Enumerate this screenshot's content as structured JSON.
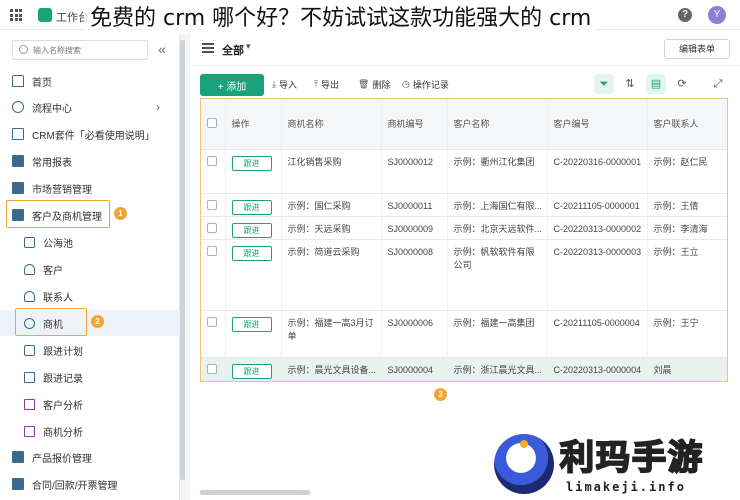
{
  "header": {
    "app_name": "工作台",
    "overlay_title": "免费的 crm 哪个好？不妨试试这款功能强大的 crm",
    "help_label": "?",
    "avatar_label": "Y"
  },
  "sidebar": {
    "search_placeholder": "输入名称搜索",
    "collapse_label": "«",
    "items": [
      {
        "label": "首页",
        "icon": "home-icon"
      },
      {
        "label": "流程中心",
        "icon": "flow-icon",
        "chevron": "›"
      },
      {
        "label": "CRM套件「必看使用说明」",
        "icon": "doc-icon"
      },
      {
        "label": "常用报表",
        "icon": "folder-icon"
      },
      {
        "label": "市场营销管理",
        "icon": "folder-icon"
      },
      {
        "label": "客户及商机管理",
        "icon": "folder-icon",
        "badge": "1"
      },
      {
        "label": "公海池",
        "icon": "pool-icon"
      },
      {
        "label": "客户",
        "icon": "customer-icon"
      },
      {
        "label": "联系人",
        "icon": "contact-icon"
      },
      {
        "label": "商机",
        "icon": "opportunity-icon",
        "badge": "2"
      },
      {
        "label": "跟进计划",
        "icon": "calendar-icon"
      },
      {
        "label": "跟进记录",
        "icon": "record-icon"
      },
      {
        "label": "客户分析",
        "icon": "chart-icon"
      },
      {
        "label": "商机分析",
        "icon": "chart-icon"
      },
      {
        "label": "产品报价管理",
        "icon": "folder-icon"
      },
      {
        "label": "合同/回款/开票管理",
        "icon": "folder-icon"
      }
    ]
  },
  "main": {
    "view_label": "全部",
    "edit_form_label": "编辑表单",
    "toolbar": {
      "add_label": "+ 添加",
      "import_label": "导入",
      "export_label": "导出",
      "delete_label": "删除",
      "log_label": "操作记录"
    },
    "columns": [
      "操作",
      "商机名称",
      "商机编号",
      "客户名称",
      "客户编号",
      "客户联系人"
    ],
    "follow_label": "跟进",
    "rows": [
      {
        "name": "江化销售采购",
        "code": "SJ0000012",
        "customer": "示例：衢州江化集团",
        "customer_code": "C-20220316-0000001",
        "contact": "示例：赵仁民"
      },
      {
        "name": "示例：国仁采购",
        "code": "SJ0000011",
        "customer": "示例：上海国仁有限...",
        "customer_code": "C-20211105-0000001",
        "contact": "示例：王倩"
      },
      {
        "name": "示例：天远采购",
        "code": "SJ0000009",
        "customer": "示例：北京天远软件...",
        "customer_code": "C-20220313-0000002",
        "contact": "示例：李清海"
      },
      {
        "name": "示例：简道云采购",
        "code": "SJ0000008",
        "customer": "示例：帆软软件有限公司",
        "customer_code": "C-20220313-0000003",
        "contact": "示例：王立"
      },
      {
        "name": "示例：福建一高3月订单",
        "code": "SJ0000006",
        "customer": "示例：福建一高集团",
        "customer_code": "C-20211105-0000004",
        "contact": "示例：王宁"
      },
      {
        "name": "示例：晨光文具设备...",
        "code": "SJ0000004",
        "customer": "示例：浙江晨光文具...",
        "customer_code": "C-20220313-0000004",
        "contact": "刘晨"
      }
    ],
    "step3_badge": "3"
  },
  "brand": {
    "name": "利玛手游",
    "url": "limakeji.info"
  }
}
